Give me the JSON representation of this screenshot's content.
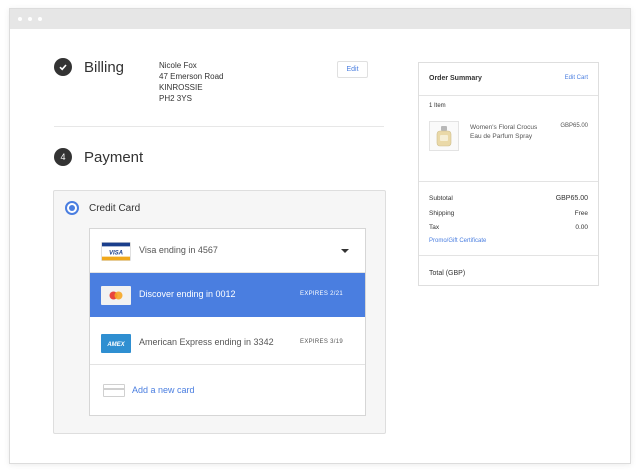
{
  "billing": {
    "title": "Billing",
    "address": [
      "Nicole Fox",
      "47 Emerson Road",
      "KINROSSIE",
      "PH2 3YS"
    ],
    "edit_label": "Edit"
  },
  "payment": {
    "step": "4",
    "title": "Payment",
    "method_label": "Credit Card",
    "cards": [
      {
        "brand": "VISA",
        "label": "Visa ending in 4567",
        "expires": "",
        "selected": false
      },
      {
        "brand": "discover",
        "label": "Discover ending in 0012",
        "expires": "EXPIRES 2/21",
        "selected": true
      },
      {
        "brand": "AMEX",
        "label": "American Express ending in 3342",
        "expires": "EXPIRES 3/19",
        "selected": false
      }
    ],
    "add_card_label": "Add a new card"
  },
  "summary": {
    "title": "Order Summary",
    "edit_cart_label": "Edit Cart",
    "items_count": "1 Item",
    "product": {
      "name": "Women's Floral Crocus Eau de Parfum Spray",
      "price": "GBP65.00"
    },
    "subtotal_label": "Subtotal",
    "subtotal_value": "GBP65.00",
    "shipping_label": "Shipping",
    "shipping_value": "Free",
    "tax_label": "Tax",
    "tax_value": "0.00",
    "promo_label": "Promo/Gift Certificate",
    "total_label": "Total (GBP)"
  },
  "colors": {
    "accent": "#4a7ee0",
    "dark": "#333333"
  }
}
